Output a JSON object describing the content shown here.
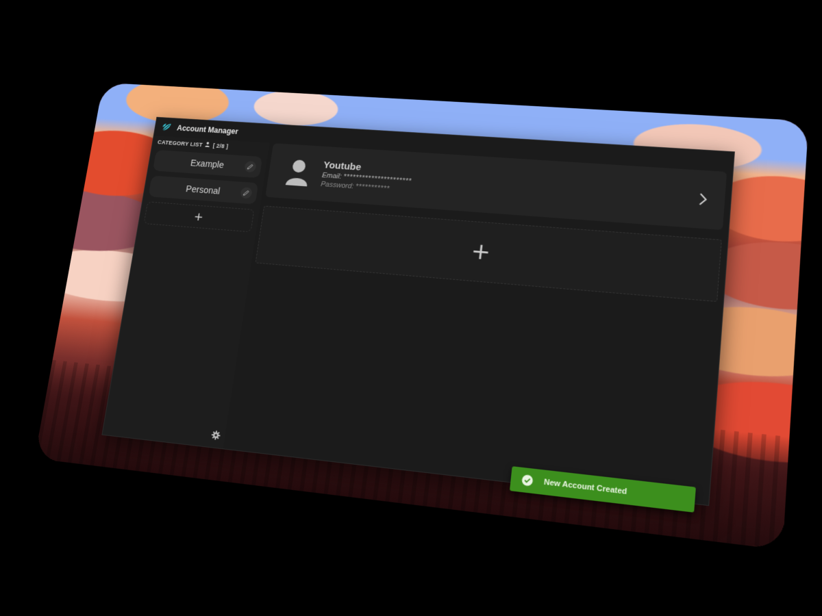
{
  "window": {
    "title": "Account Manager",
    "controls": {
      "minimize": "—",
      "maximize": "☐",
      "close": "✕"
    }
  },
  "sidebar": {
    "header_label": "CATEGORY LIST",
    "count": "[ 2/8 ]",
    "items": [
      {
        "label": "Example"
      },
      {
        "label": "Personal"
      }
    ],
    "add_label": "+"
  },
  "accounts": [
    {
      "name": "Youtube",
      "email_label": "Email:",
      "email_value": "**********************",
      "password_label": "Password:",
      "password_value": "***********"
    }
  ],
  "main": {
    "add_label": "+"
  },
  "toast": {
    "message": "New Account Created"
  },
  "colors": {
    "accent_logo": "#39c6d6",
    "toast_bg": "#3c8f1d",
    "window_bg": "#1b1b1b"
  },
  "icons": {
    "logo": "leaf-icon",
    "category_header": "user-icon",
    "edit": "pencil-icon",
    "settings": "gear-icon",
    "avatar": "user-avatar-icon",
    "open": "chevron-right-icon",
    "toast": "check-badge-icon"
  }
}
